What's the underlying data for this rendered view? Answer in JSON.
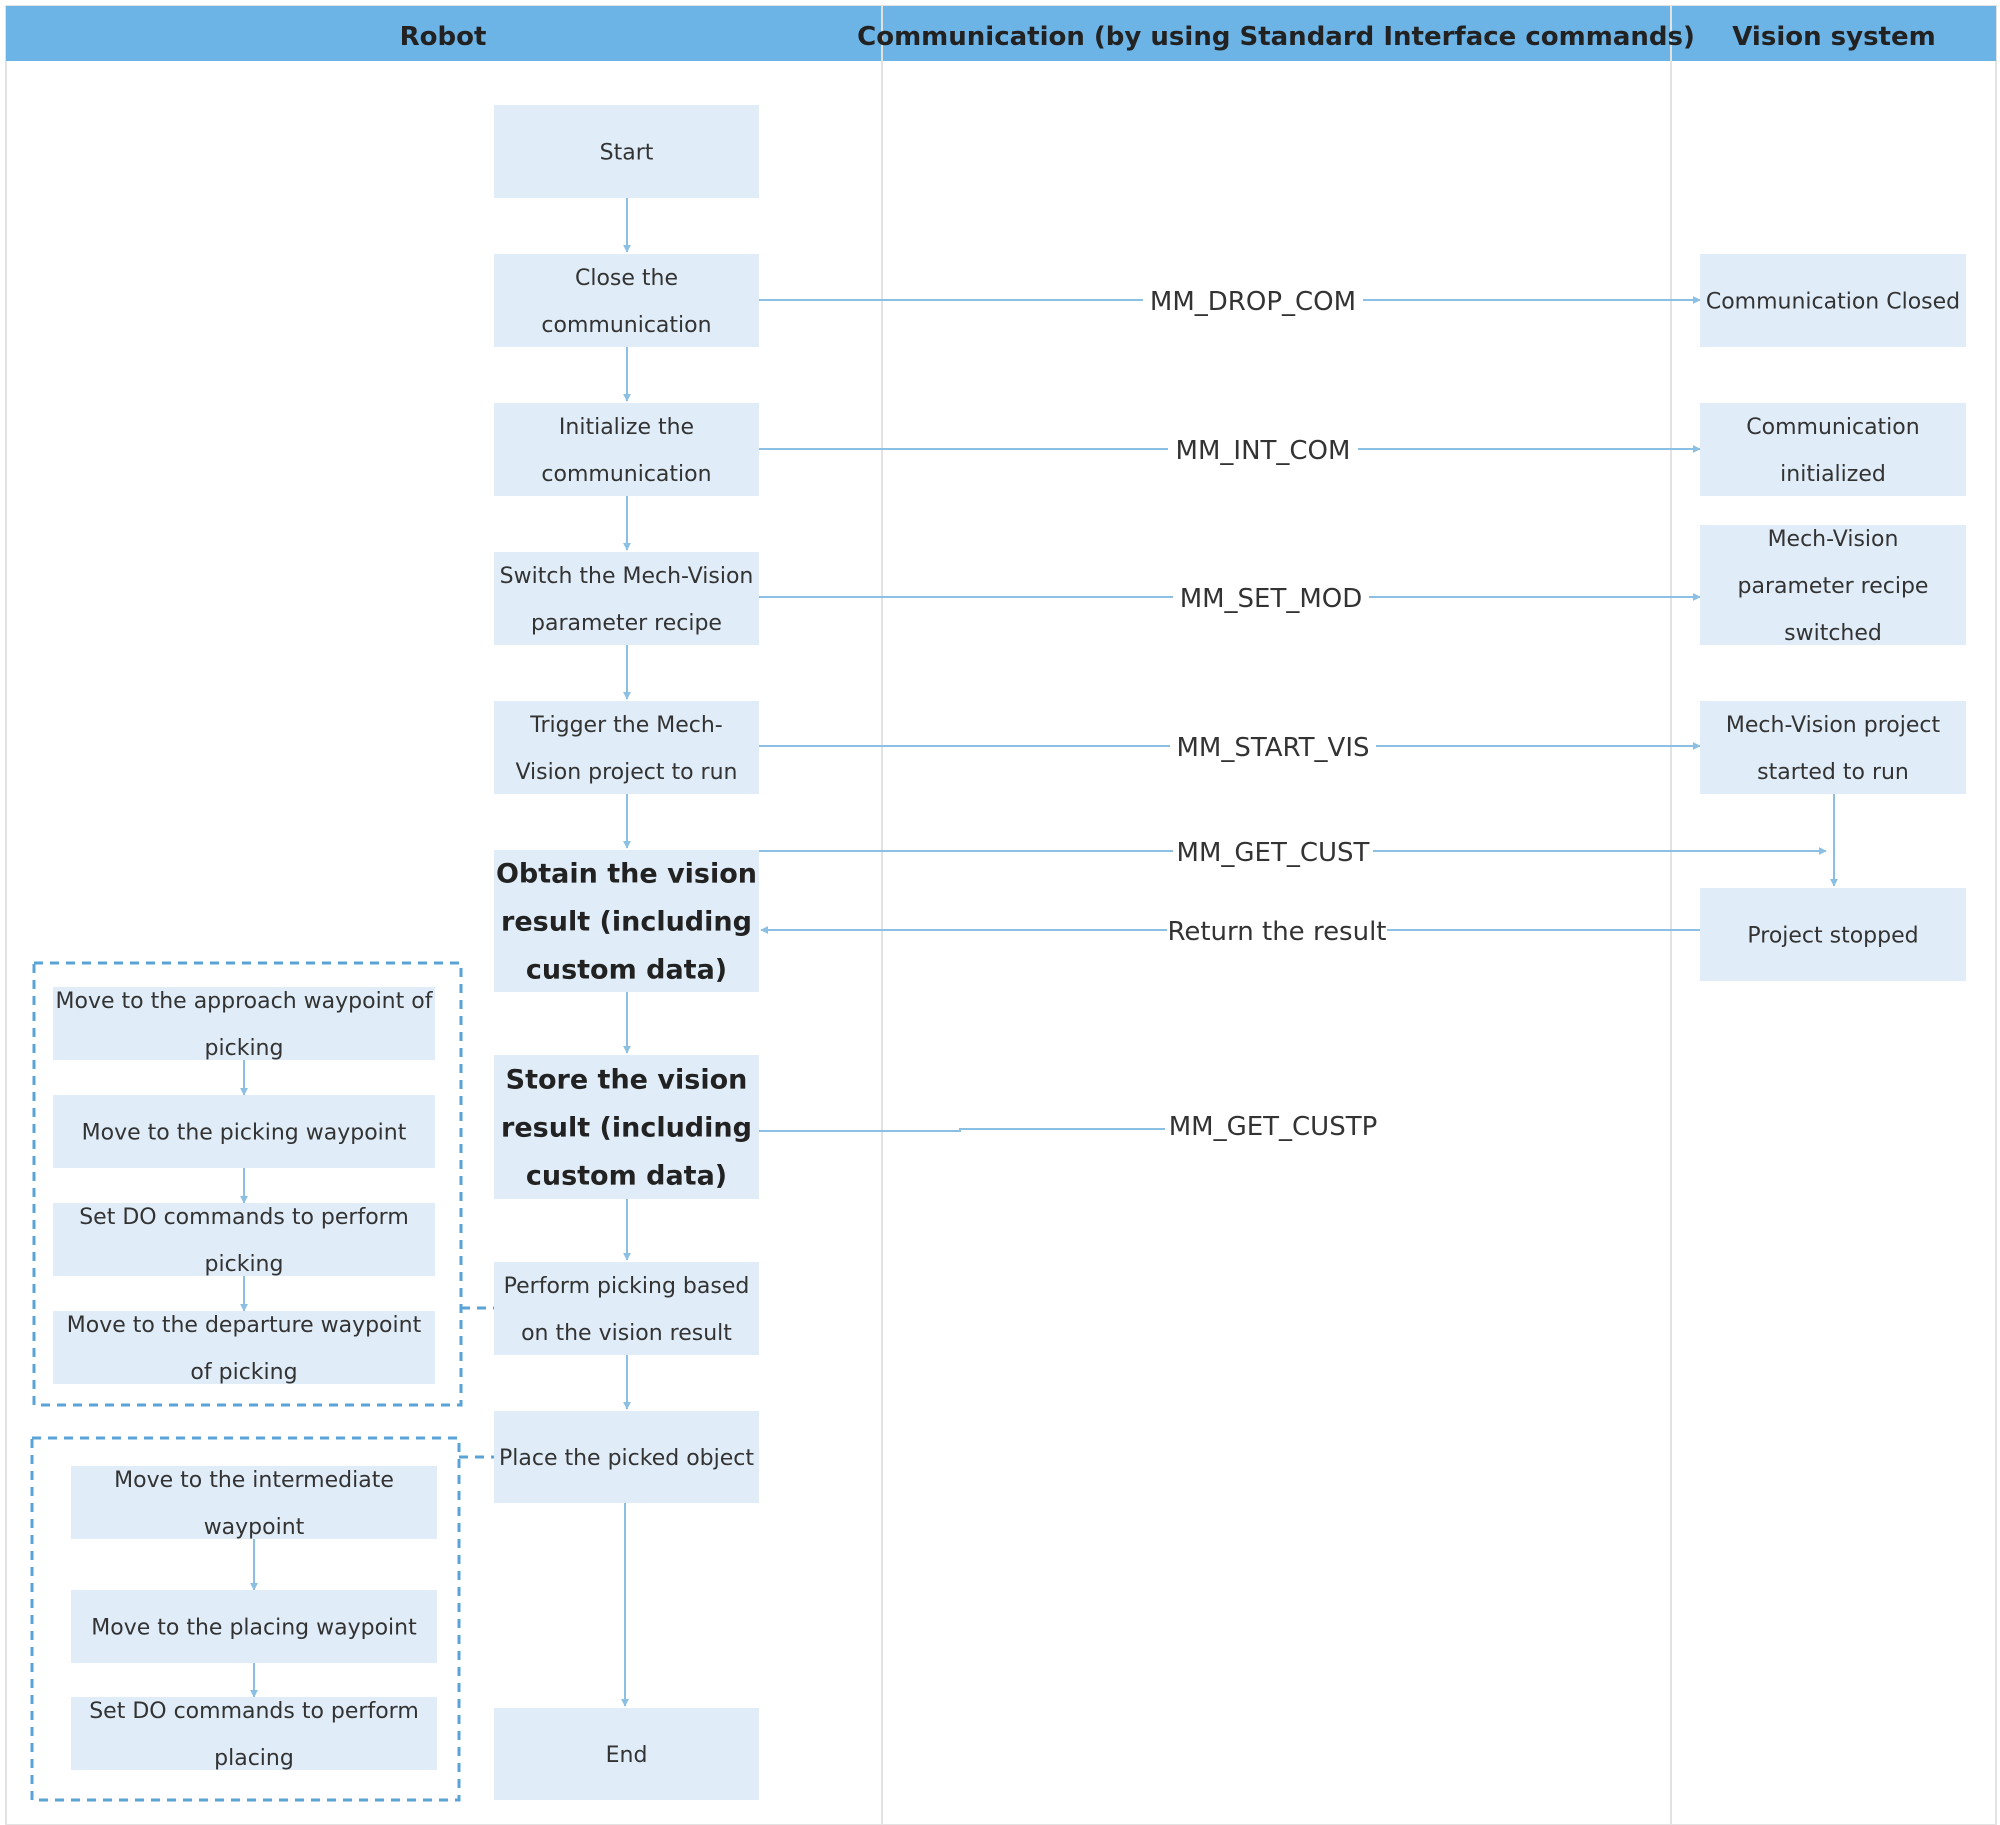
{
  "headers": {
    "robot": "Robot",
    "communication": "Communication (by using Standard Interface commands)",
    "vision": "Vision system"
  },
  "robot_steps": {
    "start": [
      "Start"
    ],
    "close_comm": [
      "Close the",
      "communication"
    ],
    "init_comm": [
      "Initialize the",
      "communication"
    ],
    "switch_recipe": [
      "Switch the Mech-Vision",
      "parameter recipe"
    ],
    "trigger_project": [
      "Trigger the Mech-",
      "Vision project to run"
    ],
    "obtain_result": [
      "Obtain the vision",
      "result (including",
      "custom data)"
    ],
    "store_result": [
      "Store the vision",
      "result (including",
      "custom data)"
    ],
    "perform_picking": [
      "Perform picking based",
      "on the vision result"
    ],
    "place_object": [
      "Place the picked object"
    ],
    "end": [
      "End"
    ]
  },
  "picking_substeps": [
    [
      "Move to the approach waypoint of",
      "picking"
    ],
    [
      "Move to the picking waypoint"
    ],
    [
      "Set DO commands to perform",
      "picking"
    ],
    [
      "Move to the departure waypoint",
      "of picking"
    ]
  ],
  "placing_substeps": [
    [
      "Move to the intermediate",
      "waypoint"
    ],
    [
      "Move to the placing waypoint"
    ],
    [
      "Set DO commands to perform",
      "placing"
    ]
  ],
  "vision_states": {
    "comm_closed": [
      "Communication Closed"
    ],
    "comm_initialized": [
      "Communication",
      "initialized"
    ],
    "recipe_switched": [
      "Mech-Vision",
      "parameter recipe",
      "switched"
    ],
    "project_started": [
      "Mech-Vision project",
      "started to run"
    ],
    "project_stopped": [
      "Project stopped"
    ]
  },
  "commands": {
    "drop_com": "MM_DROP_COM",
    "int_com": "MM_INT_COM",
    "set_mod": "MM_SET_MOD",
    "start_vis": "MM_START_VIS",
    "get_cust": "MM_GET_CUST",
    "return_result": "Return the result",
    "get_custp": "MM_GET_CUSTP"
  },
  "colors": {
    "header": "#6cb3e6",
    "box": "#e0edf8",
    "connector": "#8bbfe3",
    "dashed_group": "#5aa3d6"
  }
}
